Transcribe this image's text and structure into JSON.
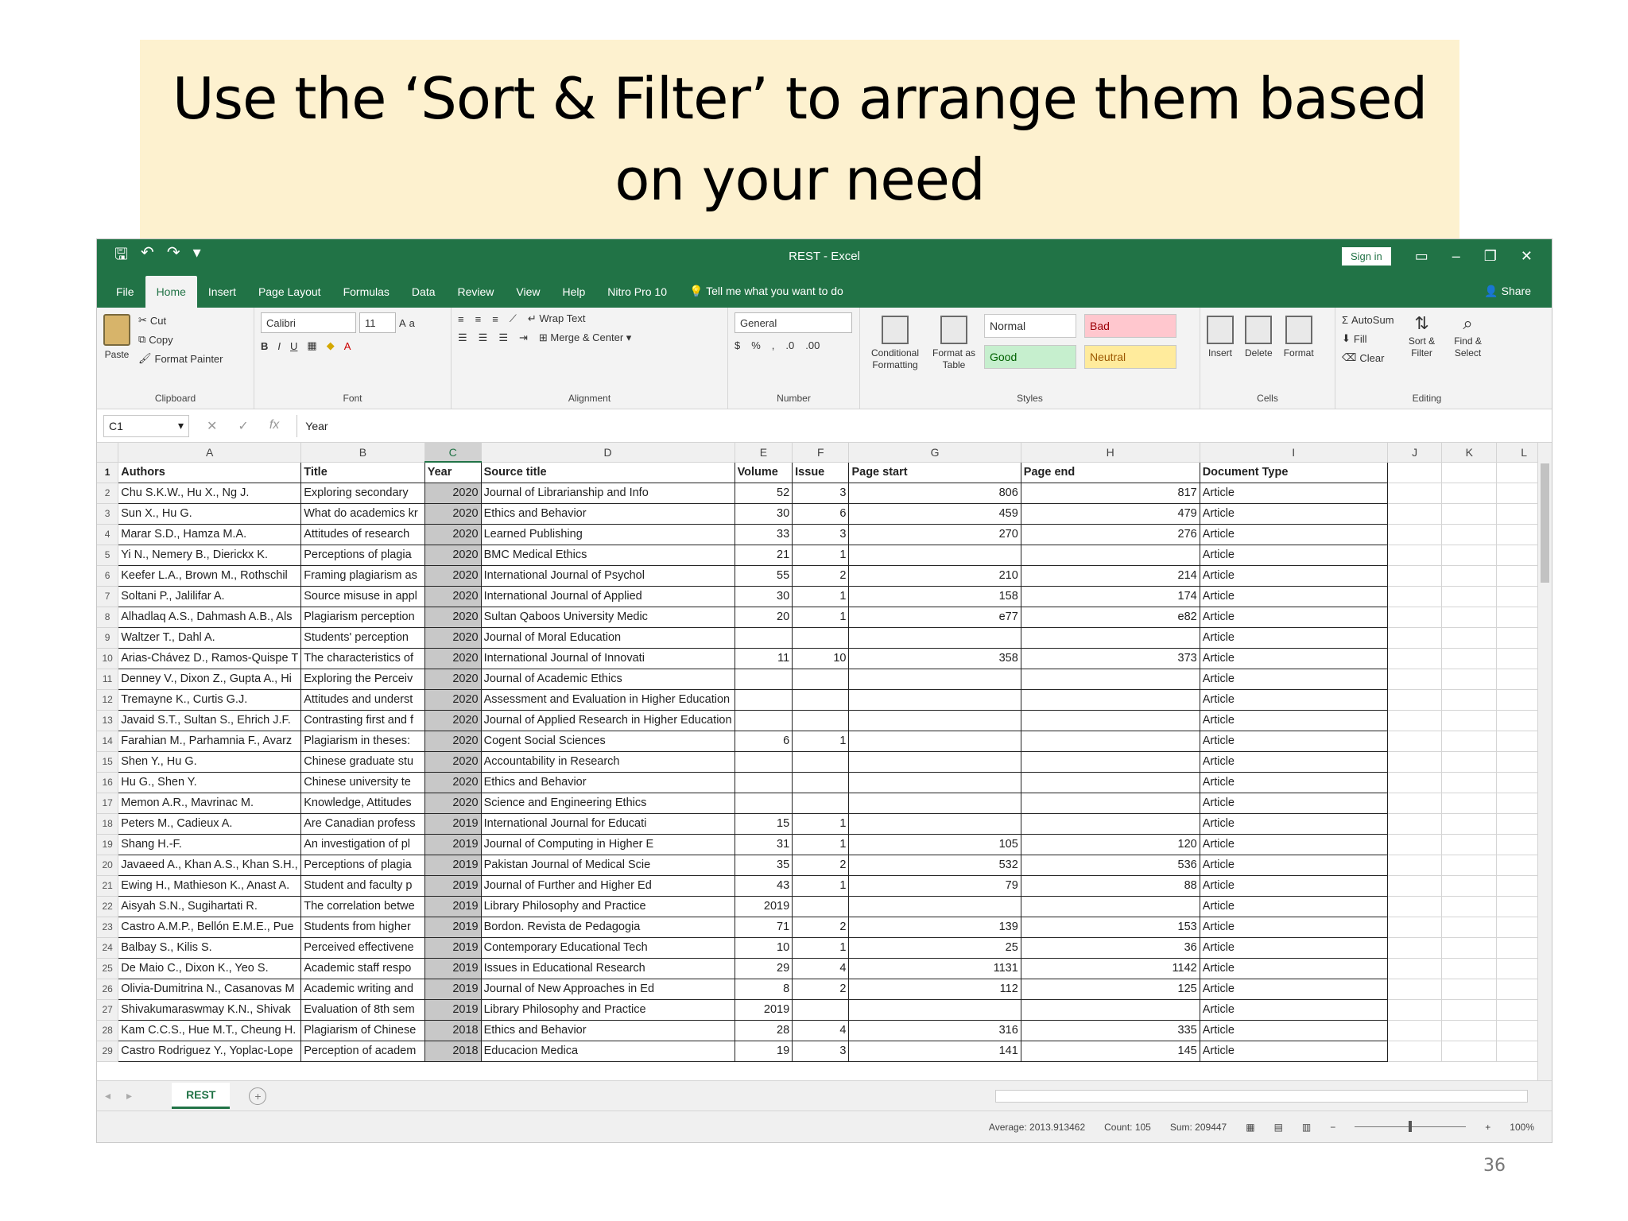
{
  "slide": {
    "title_line1": "Use the ‘Sort & Filter’ to arrange them based",
    "title_line2": "on your need",
    "page_number": "36"
  },
  "window": {
    "title": "REST - Excel",
    "sign_in": "Sign in",
    "share": "Share"
  },
  "tabs": [
    "File",
    "Home",
    "Insert",
    "Page Layout",
    "Formulas",
    "Data",
    "Review",
    "View",
    "Help",
    "Nitro Pro 10"
  ],
  "tell_me": "Tell me what you want to do",
  "ribbon": {
    "clipboard": {
      "label": "Clipboard",
      "paste": "Paste",
      "cut": "Cut",
      "copy": "Copy",
      "format_painter": "Format Painter"
    },
    "font": {
      "label": "Font",
      "name": "Calibri",
      "size": "11"
    },
    "alignment": {
      "label": "Alignment",
      "wrap_text": "Wrap Text",
      "merge_center": "Merge & Center"
    },
    "number": {
      "label": "Number",
      "format": "General"
    },
    "styles": {
      "label": "Styles",
      "conditional_formatting": "Conditional Formatting",
      "format_as_table": "Format as Table",
      "normal": "Normal",
      "bad": "Bad",
      "good": "Good",
      "neutral": "Neutral"
    },
    "cells": {
      "label": "Cells",
      "insert": "Insert",
      "delete": "Delete",
      "format": "Format"
    },
    "editing": {
      "label": "Editing",
      "autosum": "AutoSum",
      "fill": "Fill",
      "clear": "Clear",
      "sort_filter": "Sort & Filter",
      "find_select": "Find & Select"
    }
  },
  "formula_bar": {
    "cell_ref": "C1",
    "formula": "Year"
  },
  "columns": [
    "A",
    "B",
    "C",
    "D",
    "E",
    "F",
    "G",
    "H",
    "I",
    "J",
    "K",
    "L"
  ],
  "headers": [
    "Authors",
    "Title",
    "Year",
    "Source title",
    "Volume",
    "Issue",
    "Page start",
    "Page end",
    "Document Type"
  ],
  "rows": [
    [
      "Chu S.K.W., Hu X., Ng J.",
      "Exploring secondary",
      "2020",
      "Journal of Librarianship and Info",
      "52",
      "3",
      "806",
      "817",
      "Article"
    ],
    [
      "Sun X., Hu G.",
      "What do academics kr",
      "2020",
      "Ethics and Behavior",
      "30",
      "6",
      "459",
      "479",
      "Article"
    ],
    [
      "Marar S.D., Hamza M.A.",
      "Attitudes of research",
      "2020",
      "Learned Publishing",
      "33",
      "3",
      "270",
      "276",
      "Article"
    ],
    [
      "Yi N., Nemery B., Dierickx K.",
      "Perceptions of plagia",
      "2020",
      "BMC Medical Ethics",
      "21",
      "1",
      "",
      "",
      "Article"
    ],
    [
      "Keefer L.A., Brown M., Rothschil",
      "Framing plagiarism as",
      "2020",
      "International Journal of Psychol",
      "55",
      "2",
      "210",
      "214",
      "Article"
    ],
    [
      "Soltani P., Jalilifar A.",
      "Source misuse in appl",
      "2020",
      "International Journal of Applied",
      "30",
      "1",
      "158",
      "174",
      "Article"
    ],
    [
      "Alhadlaq A.S., Dahmash A.B., Als",
      "Plagiarism perception",
      "2020",
      "Sultan Qaboos University Medic",
      "20",
      "1",
      "e77",
      "e82",
      "Article"
    ],
    [
      "Waltzer T., Dahl A.",
      "Students' perception",
      "2020",
      "Journal of Moral Education",
      "",
      "",
      "",
      "",
      "Article"
    ],
    [
      "Arias-Chávez D., Ramos-Quispe T",
      "The characteristics of",
      "2020",
      "International Journal of Innovati",
      "11",
      "10",
      "358",
      "373",
      "Article"
    ],
    [
      "Denney V., Dixon Z., Gupta A., Hi",
      "Exploring the Perceiv",
      "2020",
      "Journal of Academic Ethics",
      "",
      "",
      "",
      "",
      "Article"
    ],
    [
      "Tremayne K., Curtis G.J.",
      "Attitudes and underst",
      "2020",
      "Assessment and Evaluation in Higher Education",
      "",
      "",
      "",
      "",
      "Article"
    ],
    [
      "Javaid S.T., Sultan S., Ehrich J.F.",
      "Contrasting first and f",
      "2020",
      "Journal of Applied Research in Higher Education",
      "",
      "",
      "",
      "",
      "Article"
    ],
    [
      "Farahian M., Parhamnia F., Avarz",
      "Plagiarism in theses:",
      "2020",
      "Cogent Social Sciences",
      "6",
      "1",
      "",
      "",
      "Article"
    ],
    [
      "Shen Y., Hu G.",
      "Chinese graduate stu",
      "2020",
      "Accountability in Research",
      "",
      "",
      "",
      "",
      "Article"
    ],
    [
      "Hu G., Shen Y.",
      "Chinese university te",
      "2020",
      "Ethics and Behavior",
      "",
      "",
      "",
      "",
      "Article"
    ],
    [
      "Memon A.R., Mavrinac M.",
      "Knowledge, Attitudes",
      "2020",
      "Science and Engineering Ethics",
      "",
      "",
      "",
      "",
      "Article"
    ],
    [
      "Peters M., Cadieux A.",
      "Are Canadian profess",
      "2019",
      "International Journal for Educati",
      "15",
      "1",
      "",
      "",
      "Article"
    ],
    [
      "Shang H.-F.",
      "An investigation of pl",
      "2019",
      "Journal of Computing in Higher E",
      "31",
      "1",
      "105",
      "120",
      "Article"
    ],
    [
      "Javaeed A., Khan A.S., Khan S.H.,",
      "Perceptions of plagia",
      "2019",
      "Pakistan Journal of Medical Scie",
      "35",
      "2",
      "532",
      "536",
      "Article"
    ],
    [
      "Ewing H., Mathieson K., Anast A.",
      "Student and faculty p",
      "2019",
      "Journal of Further and Higher Ed",
      "43",
      "1",
      "79",
      "88",
      "Article"
    ],
    [
      "Aisyah S.N., Sugihartati R.",
      "The correlation betwe",
      "2019",
      "Library Philosophy and Practice",
      "2019",
      "",
      "",
      "",
      "Article"
    ],
    [
      "Castro A.M.P., Bellón E.M.E., Pue",
      "Students from higher",
      "2019",
      "Bordon. Revista de Pedagogia",
      "71",
      "2",
      "139",
      "153",
      "Article"
    ],
    [
      "Balbay S., Kilis S.",
      "Perceived effectivene",
      "2019",
      "Contemporary Educational Tech",
      "10",
      "1",
      "25",
      "36",
      "Article"
    ],
    [
      "De Maio C., Dixon K., Yeo S.",
      "Academic staff respo",
      "2019",
      "Issues in Educational Research",
      "29",
      "4",
      "1131",
      "1142",
      "Article"
    ],
    [
      "Olivia-Dumitrina N., Casanovas M",
      "Academic writing and",
      "2019",
      "Journal of New Approaches in Ed",
      "8",
      "2",
      "112",
      "125",
      "Article"
    ],
    [
      "Shivakumaraswmay K.N., Shivak",
      "Evaluation of 8th sem",
      "2019",
      "Library Philosophy and Practice",
      "2019",
      "",
      "",
      "",
      "Article"
    ],
    [
      "Kam C.C.S., Hue M.T., Cheung H.",
      "Plagiarism of Chinese",
      "2018",
      "Ethics and Behavior",
      "28",
      "4",
      "316",
      "335",
      "Article"
    ],
    [
      "Castro Rodriguez Y., Yoplac-Lope",
      "Perception of academ",
      "2018",
      "Educacion Medica",
      "19",
      "3",
      "141",
      "145",
      "Article"
    ]
  ],
  "sheet_tab": "REST",
  "status": {
    "average": "Average: 2013.913462",
    "count": "Count: 105",
    "sum": "Sum: 209447",
    "zoom": "100%"
  }
}
